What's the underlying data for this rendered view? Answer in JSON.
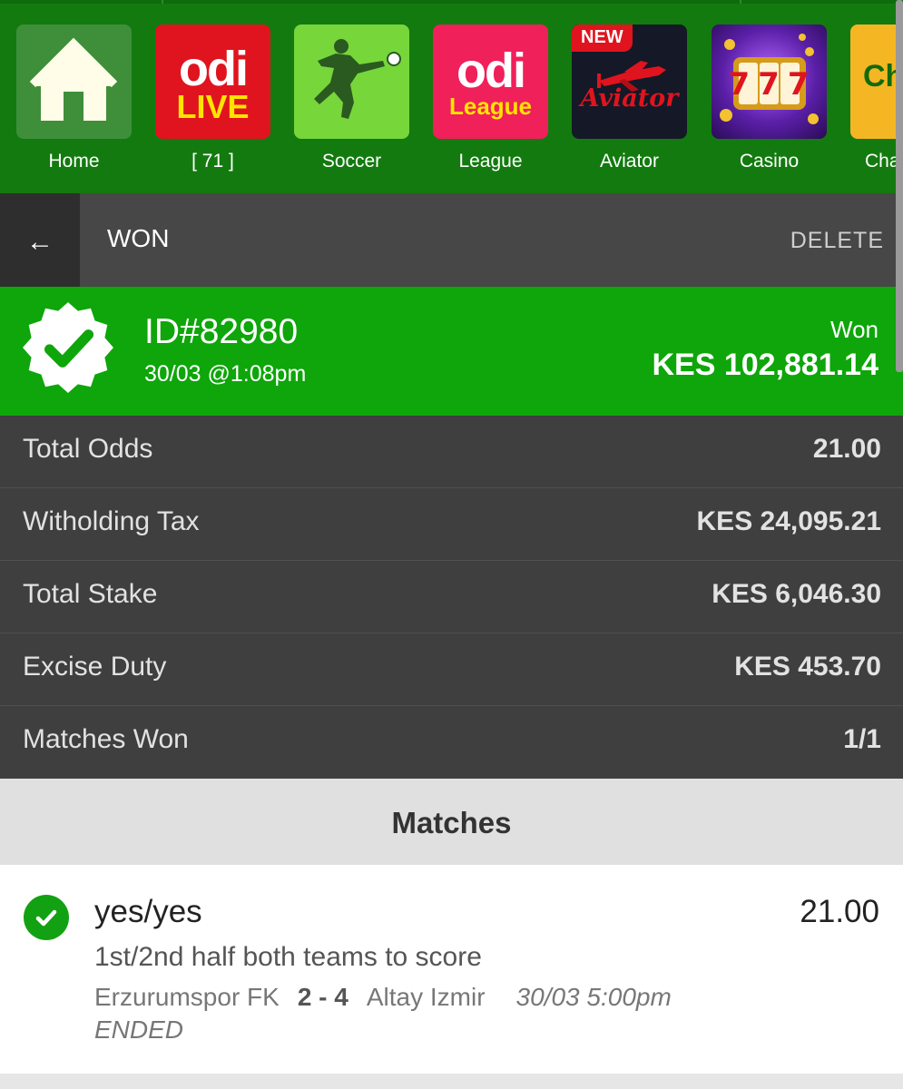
{
  "nav": {
    "items": [
      {
        "label": "Home",
        "icon": "home-icon"
      },
      {
        "label": "[ 71 ]",
        "icon": "odi-live-logo"
      },
      {
        "label": "Soccer",
        "icon": "soccer-player-icon"
      },
      {
        "label": "League",
        "icon": "odi-league-logo"
      },
      {
        "label": "Aviator",
        "icon": "aviator-logo"
      },
      {
        "label": "Casino",
        "icon": "slot-machine-icon"
      },
      {
        "label": "Chap",
        "icon": "chap-logo"
      }
    ],
    "tiles": {
      "live_line1": "odi",
      "live_line2": "LIVE",
      "league_line1": "odi",
      "league_line2": "League",
      "aviator_badge": "NEW",
      "aviator_text": "Aviator",
      "casino_text": "777",
      "chap_text": "Ch"
    }
  },
  "header": {
    "back_glyph": "←",
    "title": "WON",
    "delete_label": "DELETE"
  },
  "bet": {
    "id": "ID#82980",
    "placed": "30/03 @1:08pm",
    "status": "Won",
    "payout": "KES 102,881.14"
  },
  "summary": [
    {
      "label": "Total Odds",
      "value": "21.00"
    },
    {
      "label": "Witholding Tax",
      "value": "KES 24,095.21"
    },
    {
      "label": "Total Stake",
      "value": "KES 6,046.30"
    },
    {
      "label": "Excise Duty",
      "value": "KES 453.70"
    },
    {
      "label": "Matches Won",
      "value": "1/1"
    }
  ],
  "matches": {
    "title": "Matches",
    "items": [
      {
        "pick": "yes/yes",
        "odds": "21.00",
        "market": "1st/2nd half both teams to score",
        "home": "Erzurumspor FK",
        "score": "2 - 4",
        "away": "Altay Izmir",
        "kickoff": "30/03 5:00pm",
        "status": "ENDED"
      }
    ]
  },
  "colors": {
    "nav_green": "#137a0f",
    "banner_green": "#0ea60a",
    "summary_bg": "#3f3f3f",
    "header_bg": "#474747",
    "won_check": "#12a112"
  }
}
